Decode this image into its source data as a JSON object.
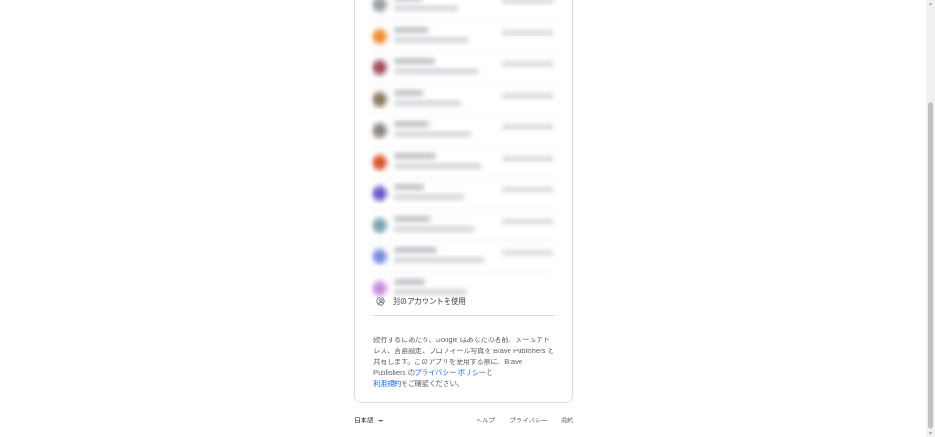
{
  "use_other_account": {
    "label": "別のアカウントを使用",
    "icon": "account-circle-icon"
  },
  "disclaimer": {
    "part1": "続行するにあたり、Google はあなたの名前、メールアドレス、言語設定、プロフィール写真を Brave Publishers と共有します。このアプリを使用する前に、Brave Publishers の",
    "privacy_link": "プライバシー ポリシー",
    "part2": "と",
    "terms_link": "利用規約",
    "part3": "をご確認ください。"
  },
  "footer": {
    "language": "日本語",
    "help": "ヘルプ",
    "privacy": "プライバシー",
    "terms": "規約"
  },
  "colors": {
    "link": "#1a73e8",
    "border": "#dadce0"
  }
}
